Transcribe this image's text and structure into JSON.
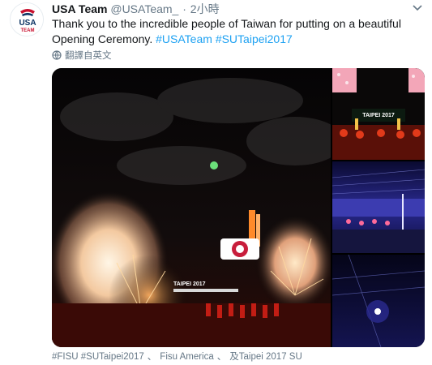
{
  "account": {
    "display_name": "USA Team",
    "handle": "@USATeam_",
    "separator": "·",
    "time": "2小時",
    "avatar_text": "USA TEAM"
  },
  "tweet": {
    "text_plain": "Thank you to the incredible people of Taiwan for putting on a beautiful Opening Ceremony.",
    "hashtags": [
      "#USATeam",
      "#SUTaipei2017"
    ]
  },
  "translate_label": "翻譯自英文",
  "media": {
    "count": 4,
    "banner_text": "TAIPEI 2017",
    "description_icons": [
      "photo-main",
      "photo-thumb-1",
      "photo-thumb-2",
      "photo-thumb-3"
    ]
  },
  "footer": {
    "hashtags": "#FISU #SUTaipei2017",
    "sep": "、",
    "mention_1": "Fisu America",
    "sep2": "、",
    "mention_2": "及Taipei 2017 SU"
  },
  "colors": {
    "link": "#1da1f2",
    "text": "#14171a",
    "muted": "#657786"
  },
  "icons": {
    "caret": "chevron-down-icon",
    "translate": "globe-icon"
  }
}
